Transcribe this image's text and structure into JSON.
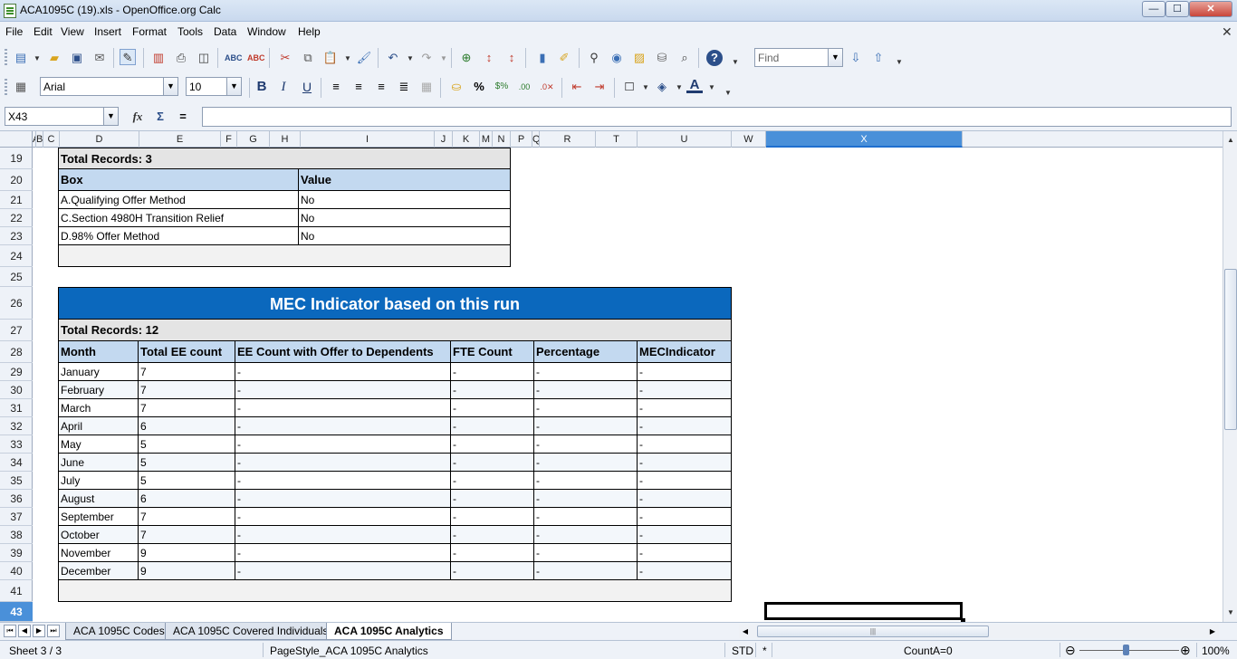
{
  "window": {
    "title": "ACA1095C (19).xls - OpenOffice.org Calc",
    "minimize": "—",
    "maximize": "☐",
    "close": "✕"
  },
  "menu": [
    "File",
    "Edit",
    "View",
    "Insert",
    "Format",
    "Tools",
    "Data",
    "Window",
    "Help"
  ],
  "find": {
    "placeholder": "Find"
  },
  "font": {
    "name": "Arial",
    "size": "10"
  },
  "formula": {
    "cell_ref": "X43",
    "value": ""
  },
  "columns": [
    "A",
    "B",
    "C",
    "D",
    "E",
    "F",
    "G",
    "H",
    "I",
    "J",
    "K",
    "M",
    "N",
    "P",
    "Q",
    "R",
    "T",
    "U",
    "W",
    "X"
  ],
  "rows": [
    "19",
    "20",
    "21",
    "22",
    "23",
    "24",
    "25",
    "26",
    "27",
    "28",
    "29",
    "30",
    "31",
    "32",
    "33",
    "34",
    "35",
    "36",
    "37",
    "38",
    "39",
    "40",
    "41",
    "43"
  ],
  "box_table": {
    "total_records": "Total Records: 3",
    "headers": [
      "Box",
      "Value"
    ],
    "rows": [
      [
        "A.Qualifying Offer Method",
        "No"
      ],
      [
        "C.Section 4980H Transition Relief",
        "No"
      ],
      [
        "D.98% Offer Method",
        "No"
      ]
    ]
  },
  "mec_table": {
    "title": "MEC Indicator based on this run",
    "total_records": "Total Records: 12",
    "headers": [
      "Month",
      "Total EE count",
      "EE Count with Offer to Dependents",
      "FTE Count",
      "Percentage",
      "MECIndicator"
    ],
    "rows": [
      [
        "January",
        "7",
        "-",
        "-",
        "-",
        "-"
      ],
      [
        "February",
        "7",
        "-",
        "-",
        "-",
        "-"
      ],
      [
        "March",
        "7",
        "-",
        "-",
        "-",
        "-"
      ],
      [
        "April",
        "6",
        "-",
        "-",
        "-",
        "-"
      ],
      [
        "May",
        "5",
        "-",
        "-",
        "-",
        "-"
      ],
      [
        "June",
        "5",
        "-",
        "-",
        "-",
        "-"
      ],
      [
        "July",
        "5",
        "-",
        "-",
        "-",
        "-"
      ],
      [
        "August",
        "6",
        "-",
        "-",
        "-",
        "-"
      ],
      [
        "September",
        "7",
        "-",
        "-",
        "-",
        "-"
      ],
      [
        "October",
        "7",
        "-",
        "-",
        "-",
        "-"
      ],
      [
        "November",
        "9",
        "-",
        "-",
        "-",
        "-"
      ],
      [
        "December",
        "9",
        "-",
        "-",
        "-",
        "-"
      ]
    ]
  },
  "tabs": [
    "ACA 1095C Codes",
    "ACA 1095C Covered Individuals",
    "ACA 1095C Analytics"
  ],
  "active_tab": "ACA 1095C Analytics",
  "status": {
    "sheet": "Sheet 3 / 3",
    "page_style": "PageStyle_ACA 1095C Analytics",
    "mode": "STD",
    "modified": "*",
    "sum": "CountA=0",
    "zoom": "100%"
  },
  "colors": {
    "title_fill": "#0b68bd",
    "header_fill": "#c3d9f0",
    "total_fill": "#e4e4e4",
    "selection": "#4a90d9"
  }
}
